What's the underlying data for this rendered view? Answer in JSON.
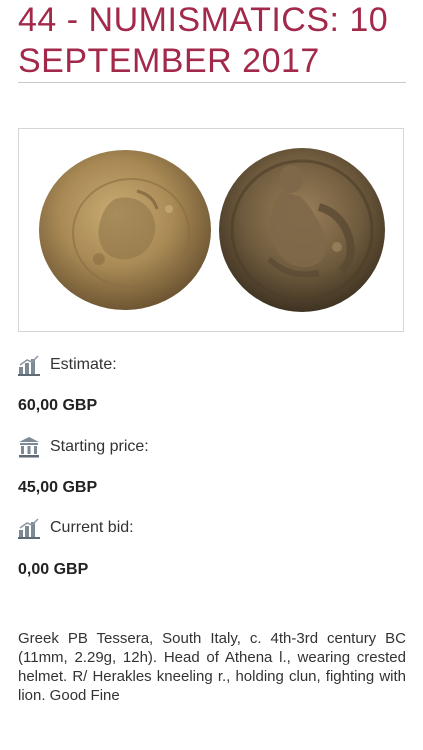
{
  "lot": {
    "title": "44 - NUMISMATICS: 10 SEPTEMBER 2017"
  },
  "image": {
    "alt": "Greek PB Tessera, obverse and reverse"
  },
  "details": {
    "estimate_label": "Estimate:",
    "estimate_value": "60,00 GBP",
    "estimate_icon": "chart-icon",
    "starting_price_label": "Starting price:",
    "starting_price_value": "45,00 GBP",
    "starting_price_icon": "bank-icon",
    "current_bid_label": "Current bid:",
    "current_bid_value": "0,00 GBP",
    "current_bid_icon": "chart-icon"
  },
  "description": "Greek PB Tessera, South Italy, c. 4th-3rd century BC (11mm, 2.29g, 12h). Head of Athena l., wearing crested helmet. R/ Herakles kneeling r., holding clun, fighting with lion. Good Fine",
  "colors": {
    "title": "#a3294a",
    "icon": "#7d8a96"
  }
}
